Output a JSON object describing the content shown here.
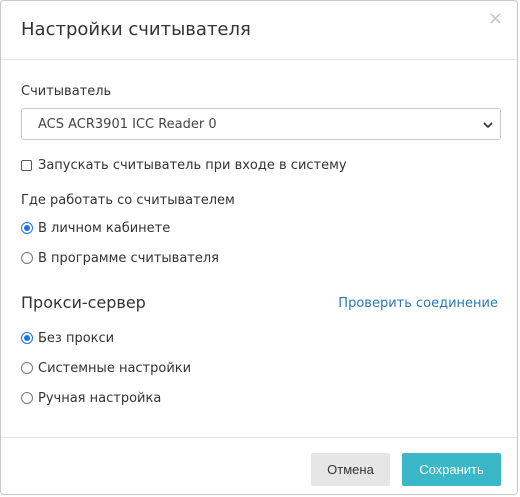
{
  "dialog": {
    "title": "Настройки считывателя",
    "close_glyph": "×"
  },
  "reader": {
    "label": "Считыватель",
    "selected": "ACS ACR3901 ICC Reader 0",
    "autostart_label": "Запускать считыватель при входе в систему",
    "autostart_checked": false
  },
  "work_location": {
    "label": "Где работать со считывателем",
    "options": [
      {
        "label": "В личном кабинете",
        "checked": true
      },
      {
        "label": "В программе считывателя",
        "checked": false
      }
    ]
  },
  "proxy": {
    "title": "Прокси-сервер",
    "check_link": "Проверить соединение",
    "options": [
      {
        "label": "Без прокси",
        "checked": true
      },
      {
        "label": "Системные настройки",
        "checked": false
      },
      {
        "label": "Ручная настройка",
        "checked": false
      }
    ]
  },
  "footer": {
    "cancel_label": "Отмена",
    "save_label": "Сохранить"
  },
  "colors": {
    "accent": "#3ab8c8",
    "link": "#2a7ab5",
    "radio_checked": "#1a73e8"
  }
}
